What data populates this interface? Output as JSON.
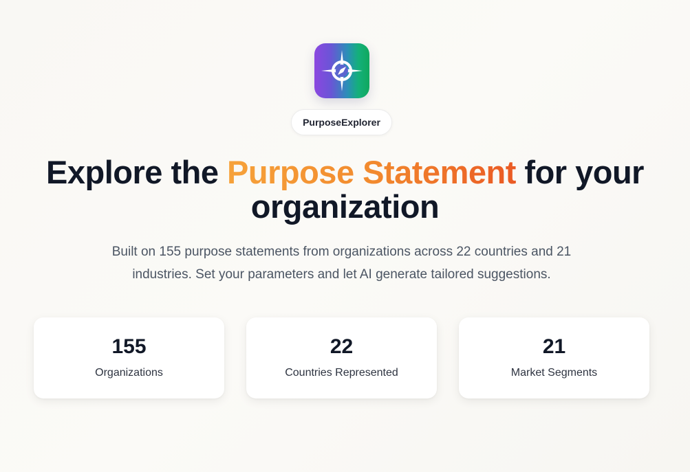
{
  "brand": {
    "icon": "compass-icon",
    "name": "PurposeExplorer",
    "gradient": [
      "#8b47e0",
      "#0fa85e"
    ]
  },
  "hero": {
    "title_prefix": "Explore the ",
    "title_highlight": "Purpose Statement",
    "title_suffix_line1": " for your",
    "title_line2": "organization",
    "highlight_colors": [
      "#f6a23a",
      "#ea5a24"
    ],
    "subtitle": "Built on 155 purpose statements from organizations across 22 countries and 21 industries. Set your parameters and let AI generate tailored suggestions."
  },
  "stats": [
    {
      "value": "155",
      "label": "Organizations"
    },
    {
      "value": "22",
      "label": "Countries Represented"
    },
    {
      "value": "21",
      "label": "Market Segments"
    }
  ]
}
